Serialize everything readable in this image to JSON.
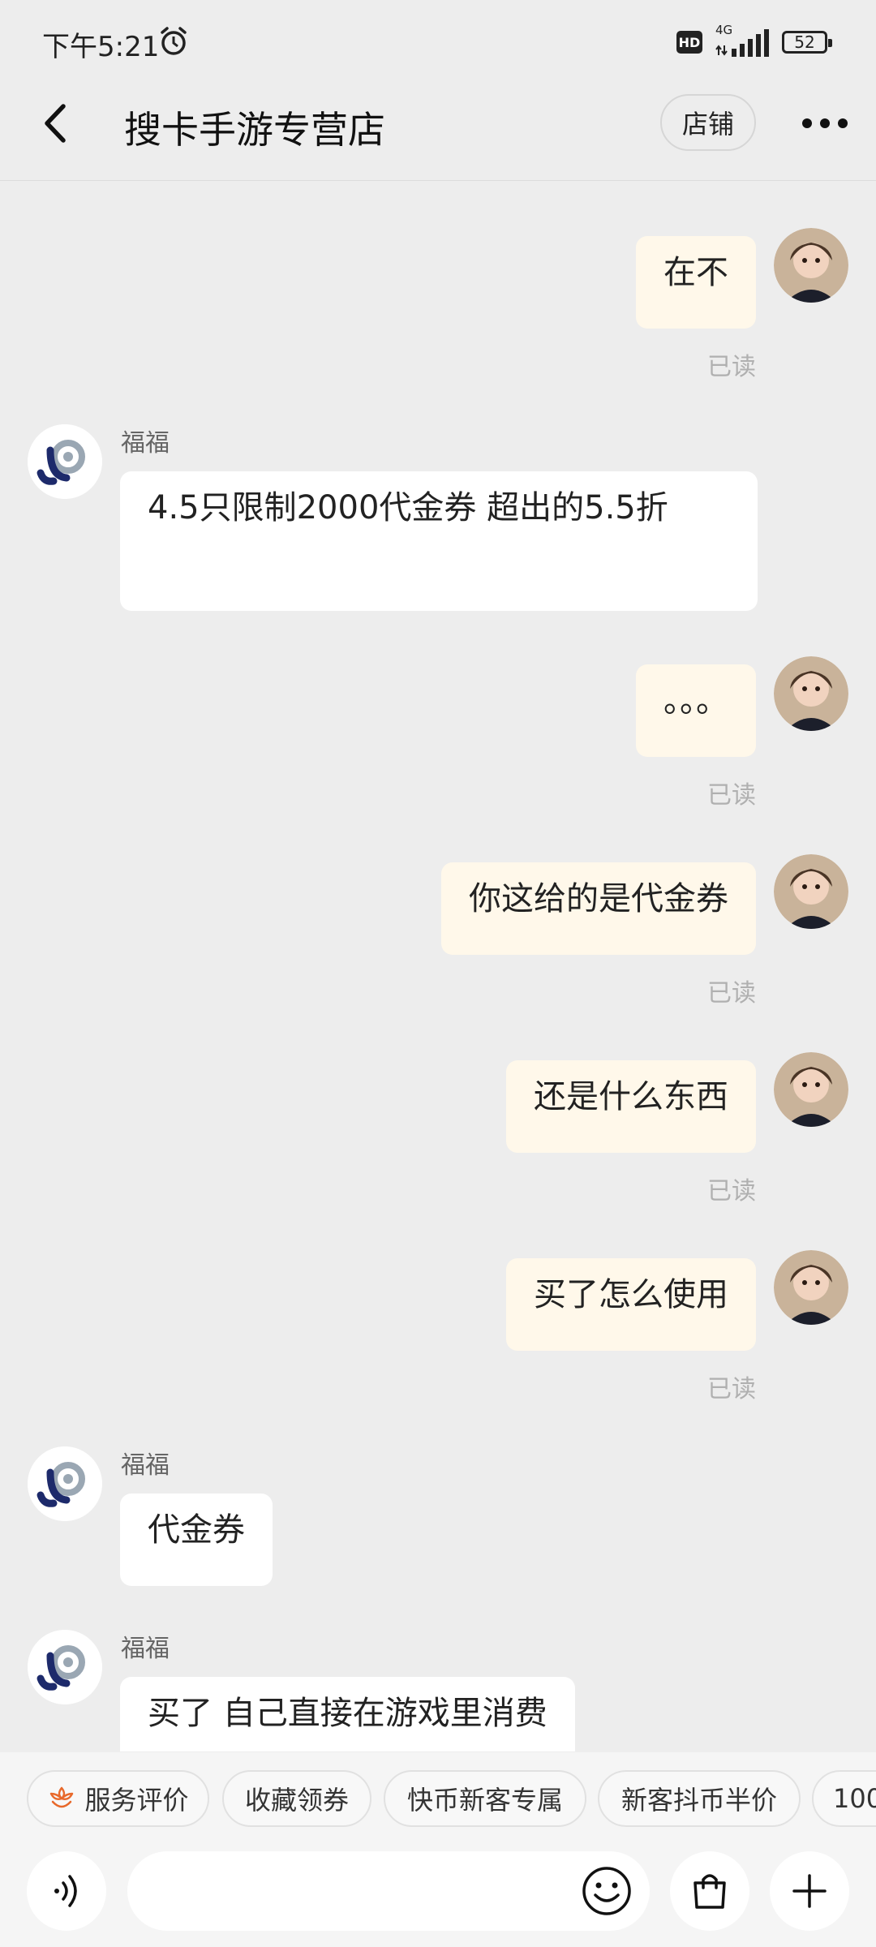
{
  "status": {
    "time": "下午5:21",
    "hd": "HD",
    "network": "4G",
    "battery": "52"
  },
  "header": {
    "title": "搜卡手游专营店",
    "shop_label": "店铺"
  },
  "messages": [
    {
      "side": "mine",
      "text": "在不",
      "read": "已读"
    },
    {
      "side": "theirs",
      "sender": "福福",
      "text": "4.5只限制2000代金券     超出的5.5折"
    },
    {
      "side": "mine",
      "text": "。。。",
      "read": "已读"
    },
    {
      "side": "mine",
      "text": "你这给的是代金券",
      "read": "已读"
    },
    {
      "side": "mine",
      "text": "还是什么东西",
      "read": "已读"
    },
    {
      "side": "mine",
      "text": "买了怎么使用",
      "read": "已读"
    },
    {
      "side": "theirs",
      "sender": "福福",
      "text": "代金券"
    },
    {
      "side": "theirs",
      "sender": "福福",
      "text": "买了 自己直接在游戏里消费"
    }
  ],
  "quick_replies": [
    "服务评价",
    "收藏领券",
    "快币新客专属",
    "新客抖币半价",
    "100"
  ],
  "input": {
    "placeholder": ""
  },
  "colors": {
    "my_bubble": "#fff8ea",
    "their_bubble": "#ffffff",
    "background": "#ededed",
    "accent": "#e8692b"
  }
}
